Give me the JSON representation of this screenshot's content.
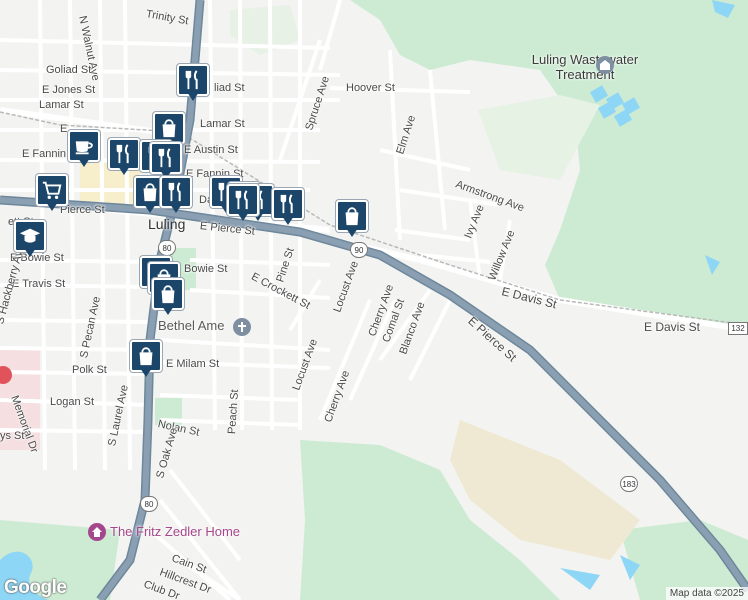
{
  "colors": {
    "land": "#f3f3f1",
    "green": "#cdebd2",
    "sand": "#efe9d4",
    "water": "#8ed6f5",
    "road": "#ffffff",
    "street_casing": "#d8dadf",
    "highway": "#8a9fb2",
    "pin": "#1b466a",
    "purple_poi": "#a5478c"
  },
  "town": "Luling",
  "places": {
    "wastewater": "Luling Wastewater\nTreatment",
    "church": "Bethel Ame",
    "home": "The Fritz Zedler Home"
  },
  "streets": {
    "trinity": "Trinity St",
    "walnut": "N Walnut Ave",
    "goliad": "Goliad St",
    "goliad2": "liad St",
    "jones": "E Jones St",
    "lamar": "Lamar St",
    "lamar_e": "Lamar St",
    "e_trunc": "E",
    "e_fannin_w": "E Fannin",
    "e_austin": "E Austin St",
    "e_fannin": "E Fannin St",
    "davis_frag": "Da",
    "pierce_w": "Pierce St",
    "e_w": "E",
    "pierce_main": "E Pierce St",
    "crockett_w": "ett St",
    "bowie_w": "E Bowie St",
    "travis": "E Travis St",
    "bowie": "Bowie St",
    "pine": "Pine St",
    "crockett": "E Crockett St",
    "locust1": "Locust Ave",
    "locust2": "Locust Ave",
    "cherry1": "Cherry Ave",
    "cherry2": "Cherry Ave",
    "comal": "Comal St",
    "blanco": "Blanco Ave",
    "spruce": "Spruce Ave",
    "hoover": "Hoover St",
    "elm": "Elm Ave",
    "armstrong": "Armstrong Ave",
    "ivy": "Ivy Ave",
    "willow": "Willow Ave",
    "e_davis1": "E Davis St",
    "e_davis2": "E Davis St",
    "e_pierce_se": "E Pierce St",
    "hackberry": "S Hackberry Ave",
    "pecan": "S Pecan Ave",
    "laurel": "S Laurel Ave",
    "polk": "Polk St",
    "logan": "Logan St",
    "nolan": "Nolan St",
    "milam": "E Milam St",
    "oak": "S Oak Ave",
    "peach": "Peach St",
    "memorial": "Memorial Dr",
    "ys": "ys St",
    "cain": "Cain St",
    "hillcrest": "Hillcrest Dr",
    "club": "Club Dr"
  },
  "shields": {
    "us90": "90",
    "us80_a": "80",
    "us80_b": "80",
    "us183": "183",
    "tx132": "132"
  },
  "pins": [
    "restaurant-pin",
    "shopping-pin",
    "cafe-pin",
    "restaurant-pin",
    "restaurant-pin",
    "restaurant-pin",
    "grocery-pin",
    "shopping-pin",
    "restaurant-pin",
    "restaurant-pin",
    "restaurant-pin",
    "restaurant-pin",
    "restaurant-pin",
    "shopping-pin",
    "school-pin",
    "shopping-pin",
    "shopping-pin",
    "shopping-pin",
    "restaurant-pin"
  ],
  "footer": {
    "logo": "Google",
    "attribution": "Map data ©2025"
  }
}
